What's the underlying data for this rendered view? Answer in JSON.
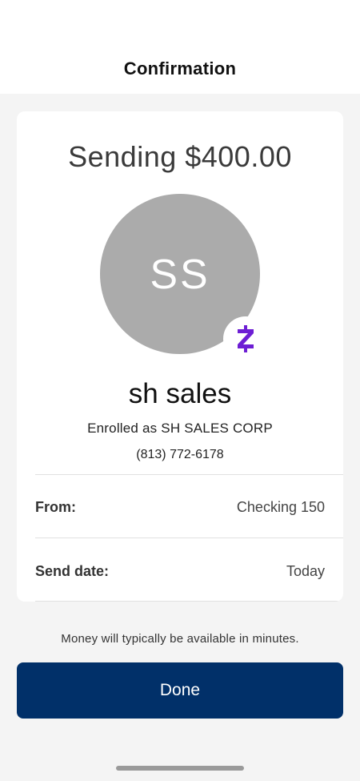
{
  "header": {
    "title": "Confirmation"
  },
  "transfer": {
    "amount_text": "Sending $400.00"
  },
  "recipient": {
    "initials": "SS",
    "name": "sh sales",
    "enrolled_text": "Enrolled as SH SALES CORP",
    "phone": "(813) 772-6178",
    "badge_icon": "zelle-icon",
    "badge_color": "#6d1ed4"
  },
  "details": [
    {
      "label": "From:",
      "value": "Checking 150"
    },
    {
      "label": "Send date:",
      "value": "Today"
    }
  ],
  "footer": {
    "note": "Money will typically be available in minutes.",
    "done_label": "Done"
  },
  "colors": {
    "primary_button": "#013069",
    "avatar_bg": "#ababab",
    "page_bg": "#f4f4f4"
  }
}
